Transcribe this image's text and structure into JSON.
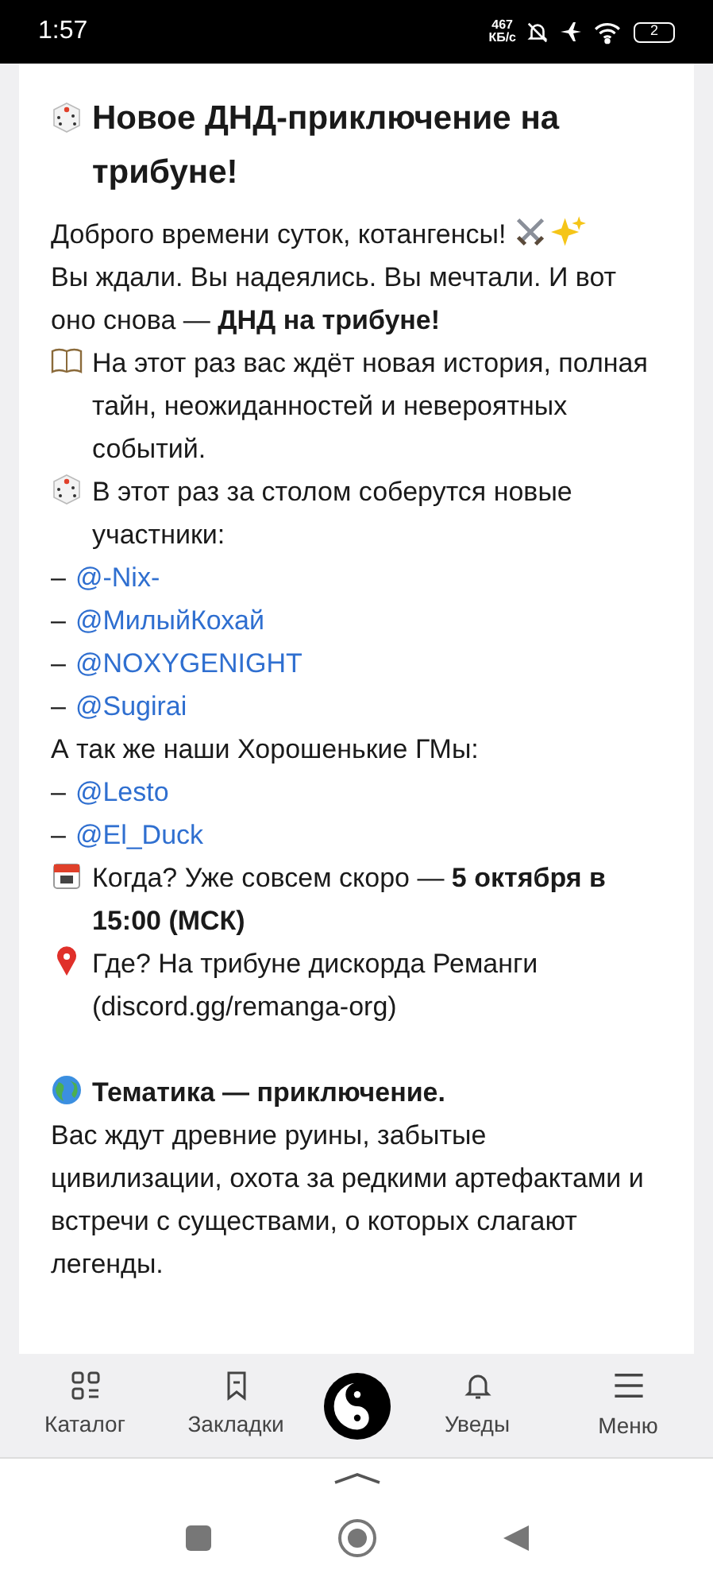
{
  "status_bar": {
    "time": "1:57",
    "speed": "467",
    "speed_unit": "КБ/с",
    "battery": "2"
  },
  "post": {
    "title": "Новое ДНД-приключение на трибуне!",
    "blocks": [
      {
        "kind": "greeting",
        "text": "Доброго времени суток, котангенсы!"
      },
      {
        "kind": "plain",
        "text": "Вы ждали. Вы надеялись. Вы мечтали. И вот оно снова — **ДНД на трибуне!**"
      },
      {
        "kind": "book",
        "text": "На этот раз вас ждёт новая история, полная тайн, неожиданностей и невероятных событий."
      },
      {
        "kind": "dice",
        "text": "В этот раз за столом соберутся новые участники:"
      },
      {
        "kind": "mention",
        "dash": "–",
        "handle": "@-Nix-"
      },
      {
        "kind": "mention",
        "dash": "–",
        "handle": "@МилыйКохай"
      },
      {
        "kind": "mention",
        "dash": "–",
        "handle": "@NOXYGENIGHT"
      },
      {
        "kind": "mention",
        "dash": "–",
        "handle": "@Sugirai"
      },
      {
        "kind": "plain",
        "text": "А так же наши Хорошенькие ГМы:"
      },
      {
        "kind": "mention",
        "dash": "–",
        "handle": "@Lesto"
      },
      {
        "kind": "mention",
        "dash": "–",
        "handle": "@El_Duck"
      },
      {
        "kind": "calendar",
        "text": "Когда? Уже совсем скоро — **5 октября в 15:00 (МСК)**"
      },
      {
        "kind": "pin",
        "text": "Где? На трибуне дискорда Реманги (discord.gg/remanga-org)"
      },
      {
        "kind": "spacer"
      },
      {
        "kind": "globe",
        "text": "Тематика — приключение."
      },
      {
        "kind": "plain",
        "text": "Вас ждут древние руины, забытые цивилизации, охота за редкими артефактами и встречи с существами, о которых слагают легенды."
      }
    ]
  },
  "bottom_nav": [
    {
      "kind": "catalog",
      "label": "Каталог"
    },
    {
      "kind": "bookmarks",
      "label": "Закладки"
    },
    {
      "kind": "logo"
    },
    {
      "kind": "bell",
      "label": "Уведы"
    },
    {
      "kind": "menu",
      "label": "Меню"
    }
  ]
}
